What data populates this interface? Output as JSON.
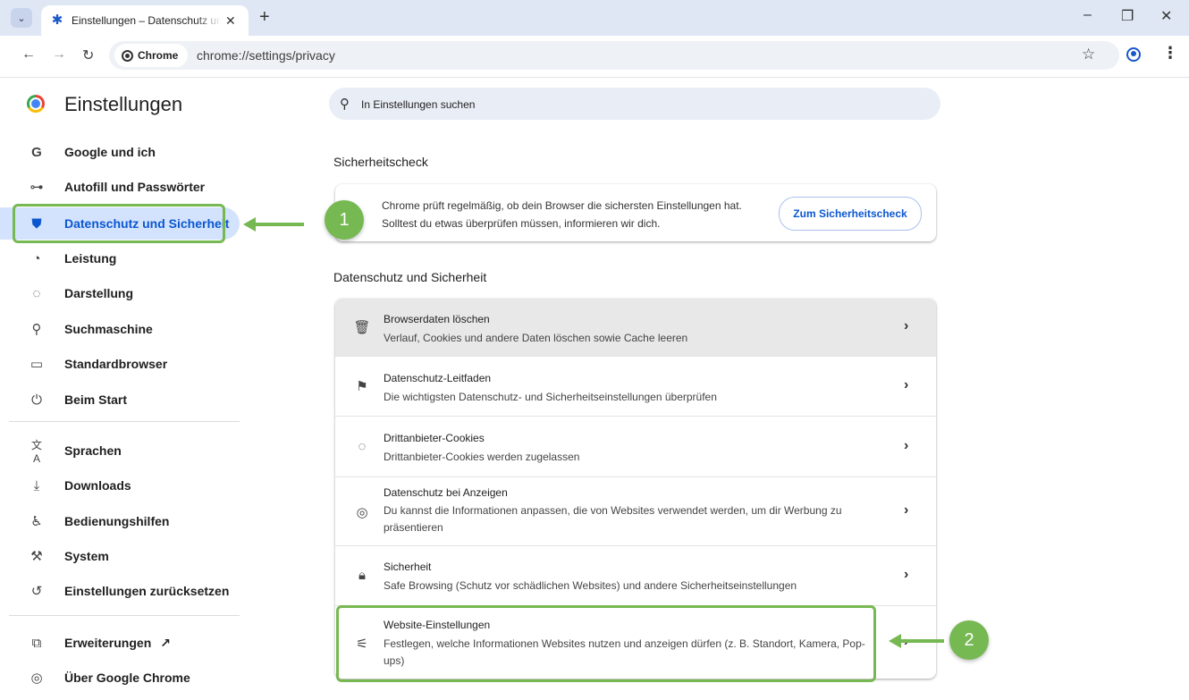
{
  "browser": {
    "tab_title": "Einstellungen – Datenschutz un",
    "tab_close": "✕",
    "new_tab": "+",
    "chip_label": "Chrome",
    "url": "chrome://settings/privacy",
    "window_controls": {
      "minimize": "–",
      "restore": "❐",
      "close": "✕"
    }
  },
  "sidebar": {
    "title": "Einstellungen",
    "items": [
      {
        "label": "Google und ich",
        "icon": "google-g-icon",
        "glyph": "G"
      },
      {
        "label": "Autofill und Passwörter",
        "icon": "key-icon",
        "glyph": "⊶"
      },
      {
        "label": "Datenschutz und Sicherheit",
        "icon": "shield-icon",
        "glyph": "⛊"
      },
      {
        "label": "Leistung",
        "icon": "speedometer-icon",
        "glyph": "◔"
      },
      {
        "label": "Darstellung",
        "icon": "palette-icon",
        "glyph": "◌"
      },
      {
        "label": "Suchmaschine",
        "icon": "search-icon",
        "glyph": "⚲"
      },
      {
        "label": "Standardbrowser",
        "icon": "browser-window-icon",
        "glyph": "▭"
      },
      {
        "label": "Beim Start",
        "icon": "power-icon",
        "glyph": "⏻"
      },
      {
        "label": "Sprachen",
        "icon": "translate-icon",
        "glyph": "文A"
      },
      {
        "label": "Downloads",
        "icon": "download-icon",
        "glyph": "⤓"
      },
      {
        "label": "Bedienungshilfen",
        "icon": "accessibility-icon",
        "glyph": "♿"
      },
      {
        "label": "System",
        "icon": "wrench-icon",
        "glyph": "⚒"
      },
      {
        "label": "Einstellungen zurücksetzen",
        "icon": "reset-icon",
        "glyph": "↺"
      },
      {
        "label": "Erweiterungen",
        "icon": "puzzle-icon",
        "glyph": "⧉"
      },
      {
        "label": "Über Google Chrome",
        "icon": "chrome-logo-icon",
        "glyph": "◎"
      }
    ]
  },
  "search": {
    "placeholder": "In Einstellungen suchen"
  },
  "safety_check": {
    "section_title": "Sicherheitscheck",
    "text": "Chrome prüft regelmäßig, ob dein Browser die sichersten Einstellungen hat. Solltest du etwas überprüfen müssen, informieren wir dich.",
    "button": "Zum Sicherheitscheck"
  },
  "privacy": {
    "section_title": "Datenschutz und Sicherheit",
    "rows": [
      {
        "title": "Browserdaten löschen",
        "desc": "Verlauf, Cookies und andere Daten löschen sowie Cache leeren",
        "icon": "trash-icon"
      },
      {
        "title": "Datenschutz-Leitfaden",
        "desc": "Die wichtigsten Datenschutz- und Sicherheitseinstellungen überprüfen",
        "icon": "signpost-icon"
      },
      {
        "title": "Drittanbieter-Cookies",
        "desc": "Drittanbieter-Cookies werden zugelassen",
        "icon": "cookie-icon"
      },
      {
        "title": "Datenschutz bei Anzeigen",
        "desc": "Du kannst die Informationen anpassen, die von Websites verwendet werden, um dir Werbung zu präsentieren",
        "icon": "ad-privacy-icon"
      },
      {
        "title": "Sicherheit",
        "desc": "Safe Browsing (Schutz vor schädlichen Websites) und andere Sicherheitseinstellungen",
        "icon": "lock-icon"
      },
      {
        "title": "Website-Einstellungen",
        "desc": "Festlegen, welche Informationen Websites nutzen und anzeigen dürfen (z. B. Standort, Kamera, Pop-ups)",
        "icon": "tune-icon"
      }
    ]
  },
  "annotations": {
    "step1": "1",
    "step2": "2",
    "accent_color": "#76b852"
  },
  "colors": {
    "active_nav_bg": "#d3e3fd",
    "active_nav_text": "#0b57d0",
    "tabstrip_bg": "#dfe7f5"
  }
}
